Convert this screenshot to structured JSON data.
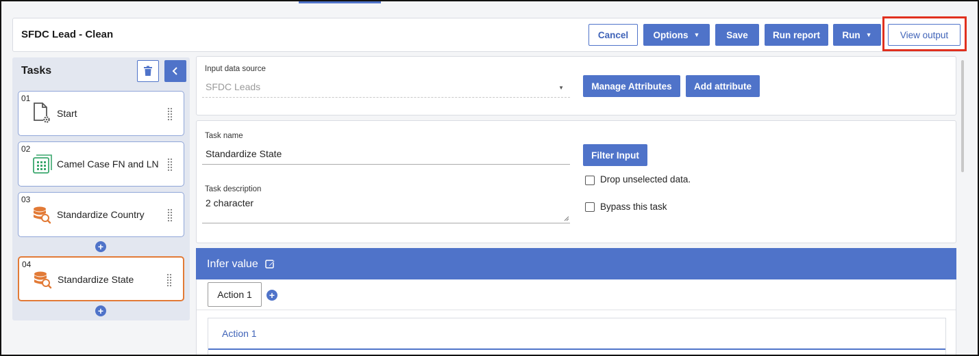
{
  "header": {
    "title": "SFDC Lead - Clean",
    "buttons": {
      "cancel": "Cancel",
      "options": "Options",
      "save": "Save",
      "run_report": "Run report",
      "run": "Run",
      "view_output": "View output"
    }
  },
  "tasks": {
    "title": "Tasks",
    "items": [
      {
        "num": "01",
        "label": "Start",
        "icon": "file-gear-icon"
      },
      {
        "num": "02",
        "label": "Camel Case FN and LN",
        "icon": "table-grid-icon"
      },
      {
        "num": "03",
        "label": "Standardize Country",
        "icon": "database-search-icon"
      },
      {
        "num": "04",
        "label": "Standardize State",
        "icon": "database-search-icon",
        "active": true
      }
    ]
  },
  "input_source": {
    "label": "Input data source",
    "value": "SFDC Leads",
    "manage_attributes": "Manage Attributes",
    "add_attribute": "Add attribute"
  },
  "task_form": {
    "name_label": "Task name",
    "name_value": "Standardize State",
    "description_label": "Task description",
    "description_value": "2 character",
    "filter_input": "Filter Input",
    "drop_unselected": "Drop unselected data.",
    "bypass_task": "Bypass this task"
  },
  "infer": {
    "title": "Infer value",
    "action_tab": "Action 1",
    "action_section_label": "Action 1"
  },
  "colors": {
    "primary": "#4f73c9",
    "active_task_border": "#e27a36",
    "highlight": "#e0301e"
  }
}
